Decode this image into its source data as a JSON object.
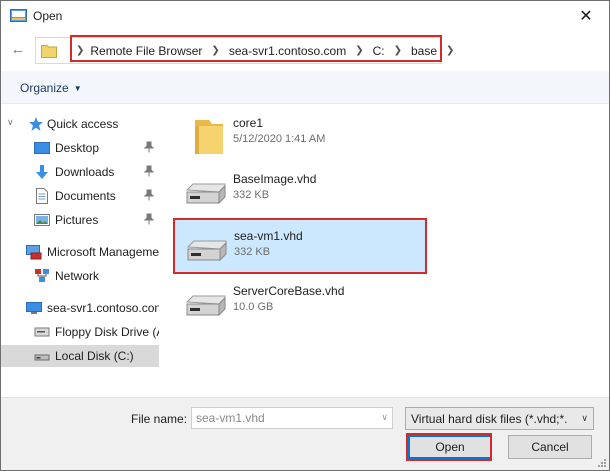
{
  "window": {
    "title": "Open",
    "close_glyph": "✕"
  },
  "address_bar": {
    "crumbs": [
      "Remote File Browser",
      "sea-svr1.contoso.com",
      "C:",
      "base"
    ]
  },
  "toolbar": {
    "organize_label": "Organize"
  },
  "nav": {
    "quick_access": "Quick access",
    "desktop": "Desktop",
    "downloads": "Downloads",
    "documents": "Documents",
    "pictures": "Pictures",
    "microsoft_management": "Microsoft Manageme",
    "network": "Network",
    "server": "sea-svr1.contoso.con",
    "floppy": "Floppy Disk Drive (A",
    "local_disk": "Local Disk (C:)"
  },
  "files": [
    {
      "name": "core1",
      "meta": "5/12/2020 1:41 AM",
      "icon": "folder-icon",
      "selected": false
    },
    {
      "name": "BaseImage.vhd",
      "meta": "332 KB",
      "icon": "hard-disk-icon",
      "selected": false
    },
    {
      "name": "sea-vm1.vhd",
      "meta": "332 KB",
      "icon": "hard-disk-icon",
      "selected": true
    },
    {
      "name": "ServerCoreBase.vhd",
      "meta": "10.0 GB",
      "icon": "hard-disk-icon",
      "selected": false
    }
  ],
  "footer": {
    "file_name_label": "File name:",
    "file_name_value": "sea-vm1.vhd",
    "filter_text": "Virtual hard disk files  (*.vhd;*.",
    "open_label": "Open",
    "cancel_label": "Cancel"
  },
  "colors": {
    "highlight_box": "#d42a2a",
    "selected_bg": "#cce8ff",
    "toolbar_bg": "#f3f6fb",
    "footer_bg": "#f0f0f0"
  }
}
